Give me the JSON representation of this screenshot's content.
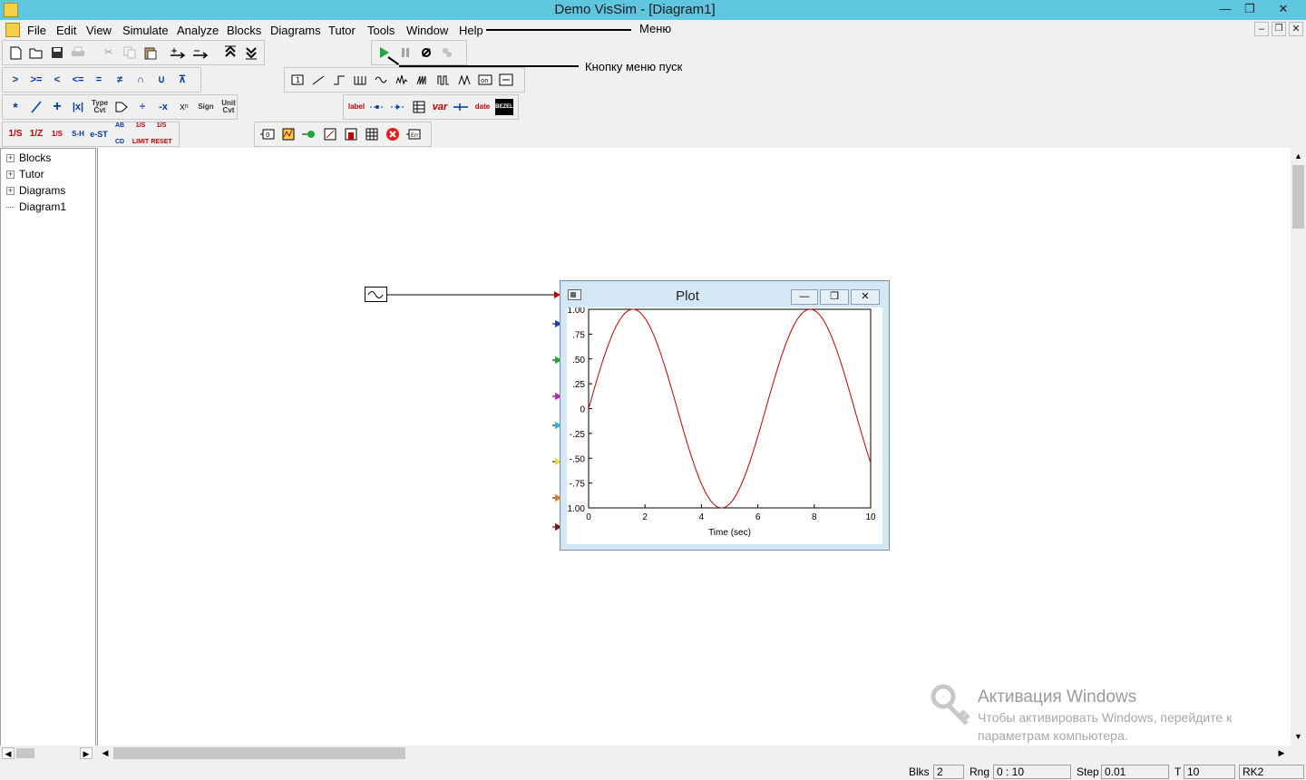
{
  "window": {
    "title": "Demo VisSim - [Diagram1]"
  },
  "menu": {
    "items": [
      "File",
      "Edit",
      "View",
      "Simulate",
      "Analyze",
      "Blocks",
      "Diagrams",
      "Tutor",
      "Tools",
      "Window",
      "Help"
    ]
  },
  "annotations": {
    "menu": "Меню",
    "run": "Кнопку меню пуск"
  },
  "toolbars": {
    "row2_compare": [
      ">",
      ">=",
      "<",
      "<=",
      "=",
      "≠",
      "∩",
      "∪",
      "⊼"
    ],
    "row3_arith_label1": "Type Cvt",
    "row3_arith_sign": "Sign",
    "row3_arith_unit": "Unit Cvt",
    "row3_annot": [
      "label",
      "var",
      "date",
      "BEZEL"
    ],
    "row4_integrators": [
      "1/S",
      "1/Z",
      "1/S",
      "S-H",
      "e-ST",
      "AB CD",
      "1/S LIMIT",
      "1/S RESET"
    ]
  },
  "tree": {
    "items": [
      "Blocks",
      "Tutor",
      "Diagrams",
      "Diagram1"
    ]
  },
  "plot": {
    "title": "Plot",
    "xlabel": "Time (sec)",
    "xticks": [
      "0",
      "2",
      "4",
      "6",
      "8",
      "10"
    ],
    "yticks": [
      "1.00",
      ".75",
      ".50",
      ".25",
      "0",
      "-.25",
      "-.50",
      "-.75",
      "-1.00"
    ]
  },
  "chart_data": {
    "type": "line",
    "title": "Plot",
    "xlabel": "Time (sec)",
    "ylabel": "",
    "xlim": [
      0,
      10
    ],
    "ylim": [
      -1,
      1
    ],
    "series": [
      {
        "function": "sin(t)",
        "color": "#c00000",
        "x": [
          0,
          0.5,
          1,
          1.5,
          2,
          2.5,
          3,
          3.5,
          4,
          4.5,
          5,
          5.5,
          6,
          6.5,
          7,
          7.5,
          8,
          8.5,
          9,
          9.5,
          10
        ],
        "y": [
          0,
          0.479,
          0.841,
          0.997,
          0.909,
          0.598,
          0.141,
          -0.351,
          -0.757,
          -0.978,
          -0.959,
          -0.706,
          -0.279,
          0.215,
          0.657,
          0.938,
          0.989,
          0.798,
          0.412,
          -0.075,
          -0.544
        ]
      }
    ]
  },
  "status": {
    "blks_label": "Blks",
    "blks_value": "2",
    "rng_label": "Rng",
    "rng_value": "0 : 10",
    "step_label": "Step",
    "step_value": "0.01",
    "t_label": "T",
    "t_value": "10",
    "solver": "RK2"
  },
  "watermark": {
    "title": "Активация Windows",
    "line1": "Чтобы активировать Windows, перейдите к",
    "line2": "параметрам компьютера."
  },
  "colors": {
    "titlebar": "#5fc6df",
    "plot_line": "#c00000",
    "run_button": "#1fa83a"
  }
}
